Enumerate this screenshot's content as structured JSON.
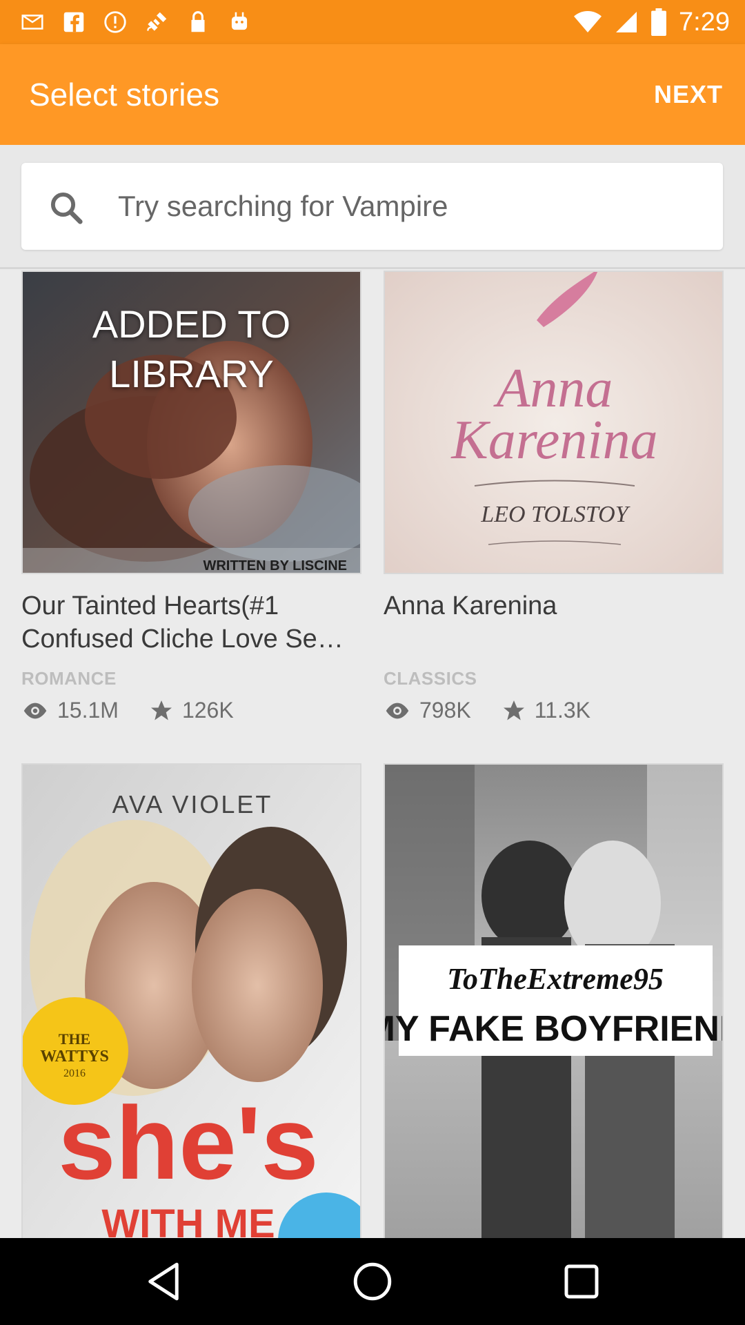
{
  "status_bar": {
    "time": "7:29",
    "left_icons": [
      "mail-icon",
      "facebook-icon",
      "alert-icon",
      "satellite-icon",
      "lock-icon",
      "android-icon"
    ],
    "right_icons": [
      "wifi-icon",
      "signal-icon",
      "battery-icon"
    ]
  },
  "app_bar": {
    "title": "Select stories",
    "next_label": "NEXT",
    "color": "#ff9825"
  },
  "search": {
    "placeholder": "Try searching for Vampire"
  },
  "stories": [
    {
      "title": "Our Tainted Hearts(#1 Confused Cliche Love Se…",
      "genre": "ROMANCE",
      "reads": "15.1M",
      "votes": "126K",
      "overlay": "ADDED TO\nLIBRARY",
      "cover_text": "WRITTEN BY LISCINE"
    },
    {
      "title": "Anna Karenina",
      "genre": "CLASSICS",
      "reads": "798K",
      "votes": "11.3K",
      "cover_title": "Anna Karenina",
      "cover_author": "LEO TOLSTOY"
    },
    {
      "cover_author": "AVA VIOLET",
      "cover_badge": "THE WATTYS 2016",
      "cover_title": "she's",
      "cover_subtitle": "WITH ME"
    },
    {
      "cover_author": "ToTheExtreme95",
      "cover_title": "MY FAKE BOYFRIEND"
    }
  ],
  "nav": {
    "icons": [
      "back-icon",
      "home-icon",
      "recents-icon"
    ]
  }
}
